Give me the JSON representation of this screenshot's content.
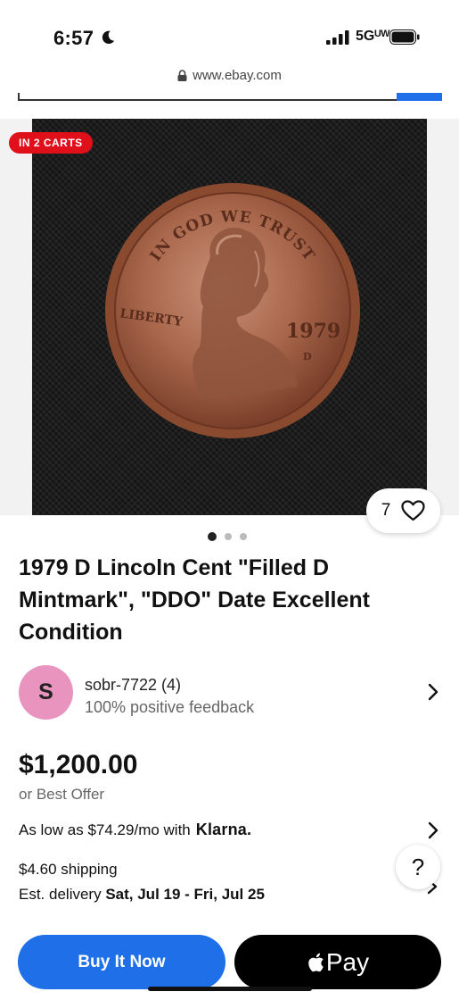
{
  "status_bar": {
    "time": "6:57",
    "network": "5Gᵁᵂ"
  },
  "browser": {
    "url": "www.ebay.com"
  },
  "listing": {
    "cart_badge": "IN 2 CARTS",
    "watch_count": "7",
    "image_count": 3,
    "active_image": 1,
    "title": "1979 D Lincoln Cent \"Filled D Mintmark\", \"DDO\" Date Excellent Condition",
    "coin": {
      "top_legend": "IN GOD WE TRUST",
      "left_legend": "LIBERTY",
      "year": "1979",
      "mint_mark": "D"
    }
  },
  "seller": {
    "initial": "S",
    "name": "sobr-7722 (4)",
    "feedback": "100% positive feedback",
    "avatar_color": "#e993bf"
  },
  "pricing": {
    "price": "$1,200.00",
    "best_offer": "or Best Offer",
    "klarna_text": "As low as $74.29/mo with",
    "klarna_brand": "Klarna."
  },
  "shipping": {
    "cost": "$4.60 shipping",
    "delivery_label": "Est. delivery",
    "delivery_range": "Sat, Jul 19 - Fri, Jul 25"
  },
  "help": {
    "label": "?"
  },
  "actions": {
    "buy_now": "Buy It Now",
    "apple_pay": "Pay"
  },
  "colors": {
    "primary_blue": "#1f6fe8",
    "badge_red": "#e0101b"
  }
}
